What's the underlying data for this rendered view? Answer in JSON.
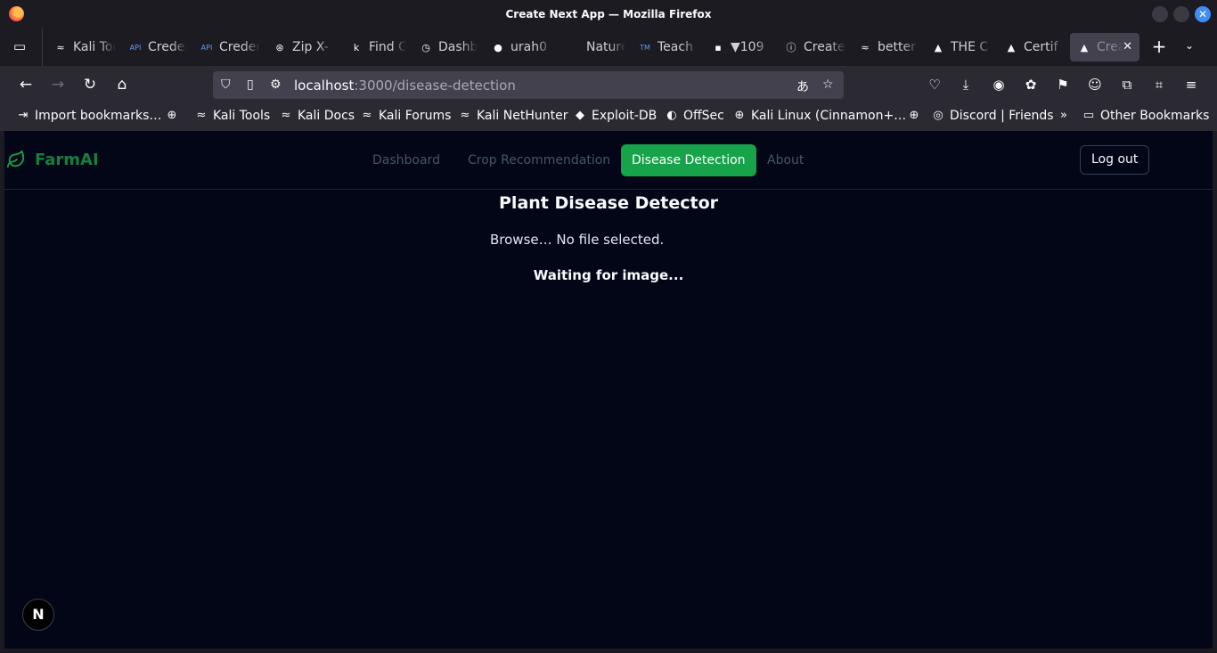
{
  "window": {
    "title": "Create Next App — Mozilla Firefox",
    "close_glyph": "✕"
  },
  "tabs": [
    {
      "label": "Kali Tools",
      "icon": "kali-dragon-icon",
      "glyph": "≈"
    },
    {
      "label": "Credentials",
      "icon": "api-icon",
      "glyph": "API"
    },
    {
      "label": "Credentials",
      "icon": "api-icon",
      "glyph": "API"
    },
    {
      "label": "Zip X-",
      "icon": "openai-icon",
      "glyph": "⊛"
    },
    {
      "label": "Find Gr",
      "icon": "k-icon",
      "glyph": "k"
    },
    {
      "label": "Dashboard",
      "icon": "clock-icon",
      "glyph": "◷"
    },
    {
      "label": "urah0",
      "icon": "github-icon",
      "glyph": "●"
    },
    {
      "label": "Nature",
      "icon": "blank-icon",
      "glyph": ""
    },
    {
      "label": "Teach",
      "icon": "tm-icon",
      "glyph": "TM"
    },
    {
      "label": "▼109",
      "icon": "ticker-icon",
      "glyph": "▪"
    },
    {
      "label": "Create",
      "icon": "info-icon",
      "glyph": "ⓘ"
    },
    {
      "label": "better",
      "icon": "kali-dragon-icon",
      "glyph": "≈"
    },
    {
      "label": "THE C",
      "icon": "drive-icon",
      "glyph": "▲"
    },
    {
      "label": "Certif",
      "icon": "drive-icon",
      "glyph": "▲"
    },
    {
      "label": "Create Next App",
      "icon": "nextjs-icon",
      "glyph": "▲",
      "active": true
    }
  ],
  "toolbar": {
    "back_glyph": "←",
    "forward_glyph": "→",
    "reload_glyph": "↻",
    "home_glyph": "⌂",
    "new_tab_glyph": "+",
    "list_tabs_glyph": "⌄"
  },
  "urlbar": {
    "host": "localhost",
    "path": ":3000/disease-detection",
    "shield_glyph": "⛉",
    "page_glyph": "▯",
    "perm_glyph": "⚙",
    "translate_glyph": "あ",
    "star_glyph": "☆"
  },
  "toolbar_icons": [
    {
      "name": "pocket-icon",
      "glyph": "♡"
    },
    {
      "name": "downloads-icon",
      "glyph": "⤓"
    },
    {
      "name": "account-icon",
      "glyph": "◉"
    },
    {
      "name": "color-extension-icon",
      "glyph": "✿"
    },
    {
      "name": "extension-icon",
      "glyph": "⚑"
    },
    {
      "name": "avatar-extension-icon",
      "glyph": "☺"
    },
    {
      "name": "extensions-icon",
      "glyph": "⧉"
    },
    {
      "name": "screenshot-icon",
      "glyph": "⌗"
    },
    {
      "name": "menu-icon",
      "glyph": "≡"
    }
  ],
  "bookmarks": [
    {
      "label": "Import bookmarks…",
      "glyph": "⇥",
      "icon": "import-icon"
    },
    {
      "label": "",
      "glyph": "⊕",
      "icon": "globe-icon"
    },
    {
      "label": "Kali Tools",
      "glyph": "≈",
      "icon": "kali-dragon-icon"
    },
    {
      "label": "Kali Docs",
      "glyph": "≈",
      "icon": "kali-dragon-icon"
    },
    {
      "label": "Kali Forums",
      "glyph": "≈",
      "icon": "kali-dragon-icon"
    },
    {
      "label": "Kali NetHunter",
      "glyph": "≈",
      "icon": "kali-dragon-icon"
    },
    {
      "label": "Exploit-DB",
      "glyph": "◆",
      "icon": "exploitdb-icon"
    },
    {
      "label": "OffSec",
      "glyph": "◐",
      "icon": "offsec-icon"
    },
    {
      "label": "Kali Linux (Cinnamon+…",
      "glyph": "⊕",
      "icon": "globe-icon"
    },
    {
      "label": "",
      "glyph": "⊕",
      "icon": "globe-icon"
    },
    {
      "label": "Discord | Friends",
      "glyph": "◎",
      "icon": "discord-icon"
    }
  ],
  "bookmarks_overflow_glyph": "»",
  "other_bookmarks": {
    "label": "Other Bookmarks",
    "glyph": "▭"
  },
  "app": {
    "brand": "FarmAI",
    "nav": [
      {
        "label": "Dashboard",
        "active": false
      },
      {
        "label": "Crop Recommendation",
        "active": false
      },
      {
        "label": "Disease Detection",
        "active": true
      },
      {
        "label": "About",
        "active": false
      }
    ],
    "logout_label": "Log out",
    "heading": "Plant Disease Detector",
    "browse_label": "Browse…",
    "file_status": "No file selected.",
    "status": "Waiting for image...",
    "next_badge": "N"
  },
  "colors": {
    "brand": "#15803d",
    "active_nav": "#16a34a",
    "page_bg": "#020617"
  }
}
